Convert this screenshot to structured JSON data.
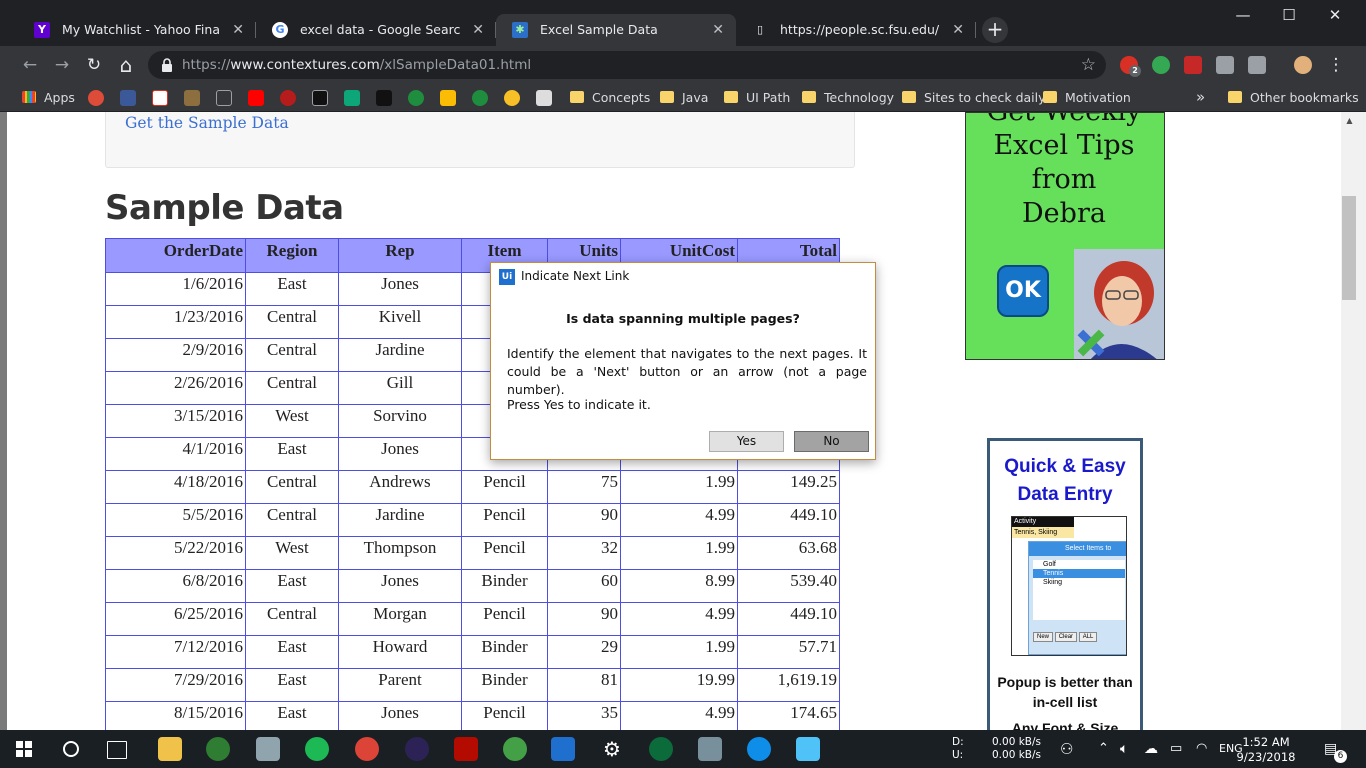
{
  "browser": {
    "tabs": [
      {
        "title": "My Watchlist - Yahoo Finance portfolio",
        "icon": "yahoo-icon",
        "color": "#5f01d1",
        "glyph": "Y"
      },
      {
        "title": "excel data - Google Search",
        "icon": "google-icon",
        "color": "#ffffff",
        "glyph": "G"
      },
      {
        "title": "Excel Sample Data",
        "icon": "contextures-icon",
        "color": "#2b6fc9",
        "glyph": "✱"
      },
      {
        "title": "https://people.sc.fsu.edu/~jburkardt",
        "icon": "page-icon",
        "color": "#e8eaed",
        "glyph": "▯"
      }
    ],
    "tab_close_glyph": "✕",
    "new_tab_glyph": "+",
    "window_controls": {
      "minimize": "—",
      "maximize": "☐",
      "close": "✕"
    },
    "nav": {
      "back": "←",
      "forward": "→",
      "reload": "↻",
      "home": "⌂"
    },
    "address": {
      "scheme": "https://",
      "host": "www.contextures.com",
      "path": "/xlSampleData01.html"
    },
    "bookmark_star": "☆",
    "extension_badge": "2",
    "menu_glyph": "⋮",
    "bookmarks": {
      "apps_label": "Apps",
      "folders": [
        "Concepts",
        "Java",
        "UI Path",
        "Technology",
        "Sites to check daily",
        "Motivation"
      ],
      "overflow": "»",
      "other": "Other bookmarks"
    }
  },
  "page": {
    "sample_link": "Get the Sample Data",
    "heading": "Sample Data",
    "table": {
      "headers": [
        "OrderDate",
        "Region",
        "Rep",
        "Item",
        "Units",
        "UnitCost",
        "Total"
      ],
      "rows": [
        [
          "1/6/2016",
          "East",
          "Jones",
          "P",
          "",
          "",
          ""
        ],
        [
          "1/23/2016",
          "Central",
          "Kivell",
          "B",
          "",
          "",
          ""
        ],
        [
          "2/9/2016",
          "Central",
          "Jardine",
          "P",
          "",
          "",
          ""
        ],
        [
          "2/26/2016",
          "Central",
          "Gill",
          "",
          "",
          "",
          ""
        ],
        [
          "3/15/2016",
          "West",
          "Sorvino",
          "P",
          "",
          "",
          ""
        ],
        [
          "4/1/2016",
          "East",
          "Jones",
          "B",
          "",
          "",
          ""
        ],
        [
          "4/18/2016",
          "Central",
          "Andrews",
          "Pencil",
          "75",
          "1.99",
          "149.25"
        ],
        [
          "5/5/2016",
          "Central",
          "Jardine",
          "Pencil",
          "90",
          "4.99",
          "449.10"
        ],
        [
          "5/22/2016",
          "West",
          "Thompson",
          "Pencil",
          "32",
          "1.99",
          "63.68"
        ],
        [
          "6/8/2016",
          "East",
          "Jones",
          "Binder",
          "60",
          "8.99",
          "539.40"
        ],
        [
          "6/25/2016",
          "Central",
          "Morgan",
          "Pencil",
          "90",
          "4.99",
          "449.10"
        ],
        [
          "7/12/2016",
          "East",
          "Howard",
          "Binder",
          "29",
          "1.99",
          "57.71"
        ],
        [
          "7/29/2016",
          "East",
          "Parent",
          "Binder",
          "81",
          "19.99",
          "1,619.19"
        ],
        [
          "8/15/2016",
          "East",
          "Jones",
          "Pencil",
          "35",
          "4.99",
          "174.65"
        ]
      ]
    },
    "ad_tips": {
      "lines": [
        "Get Weekly",
        "Excel Tips",
        "from",
        "Debra"
      ],
      "ok": "OK"
    },
    "ad_entry": {
      "title": "Quick & Easy Data Entry",
      "caption": "Popup is better than in-cell list",
      "caption_more": "Any Font & Size",
      "shot": {
        "header": "Activity",
        "value": "Tennis, Skiing",
        "panel_title": "Select Items to",
        "options": [
          "Golf",
          "Tennis",
          "Skiing"
        ],
        "buttons": [
          "New",
          "Clear",
          "ALL"
        ]
      }
    }
  },
  "dialog": {
    "app_logo": "Ui",
    "title": "Indicate Next Link",
    "question": "Is data spanning multiple pages?",
    "message": "Identify the element that navigates to the next pages. It could be a 'Next' button or an arrow (not a page number).",
    "message2": "Press Yes to indicate it.",
    "yes": "Yes",
    "no": "No"
  },
  "taskbar": {
    "net_labels": [
      "D:",
      "U:"
    ],
    "net_values": [
      "0.00 kB/s",
      "0.00 kB/s"
    ],
    "language": "ENG",
    "time": "1:52 AM",
    "date": "9/23/2018",
    "notifications": "6"
  }
}
